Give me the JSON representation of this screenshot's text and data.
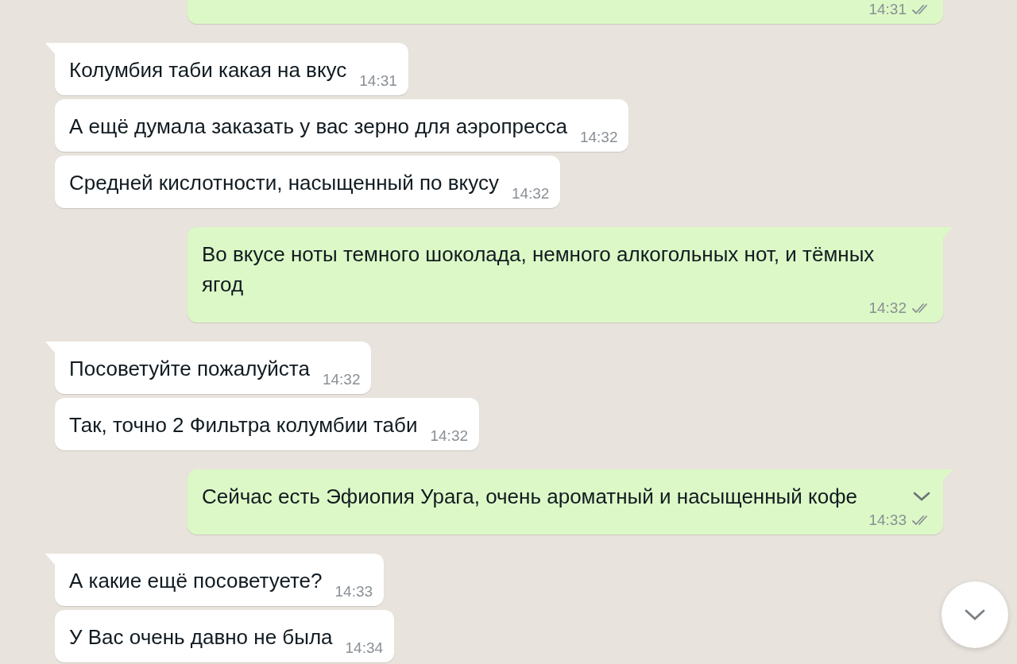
{
  "messages": [
    {
      "kind": "outgoing",
      "tail": false,
      "time": "14:31",
      "read": true
    },
    {
      "kind": "incoming",
      "tail": true,
      "text": "Колумбия таби какая на вкус",
      "time": "14:31"
    },
    {
      "kind": "incoming",
      "tail": false,
      "text": "А ещё думала заказать у вас зерно для аэропресса",
      "time": "14:32"
    },
    {
      "kind": "incoming",
      "tail": false,
      "text": "Средней кислотности, насыщенный по вкусу",
      "time": "14:32"
    },
    {
      "kind": "outgoing",
      "tail": true,
      "text": "Во вкусе ноты темного шоколада, немного алкогольных нот, и тёмных ягод",
      "time": "14:32",
      "read": true,
      "truncated": false
    },
    {
      "kind": "incoming",
      "tail": true,
      "text": "Посоветуйте пожалуйста",
      "time": "14:32"
    },
    {
      "kind": "incoming",
      "tail": false,
      "text": "Так, точно 2 Фильтра колумбии таби",
      "time": "14:32"
    },
    {
      "kind": "outgoing",
      "tail": true,
      "text": "Сейчас есть Эфиопия Урага, очень ароматный и насыщенный кофе",
      "time": "14:33",
      "read": true,
      "truncated": true
    },
    {
      "kind": "incoming",
      "tail": true,
      "text": "А какие ещё посоветуете?",
      "time": "14:33"
    },
    {
      "kind": "incoming",
      "tail": false,
      "text": "У Вас очень давно не была",
      "time": "14:34"
    }
  ],
  "scroll_down_button": {
    "visible": true
  }
}
